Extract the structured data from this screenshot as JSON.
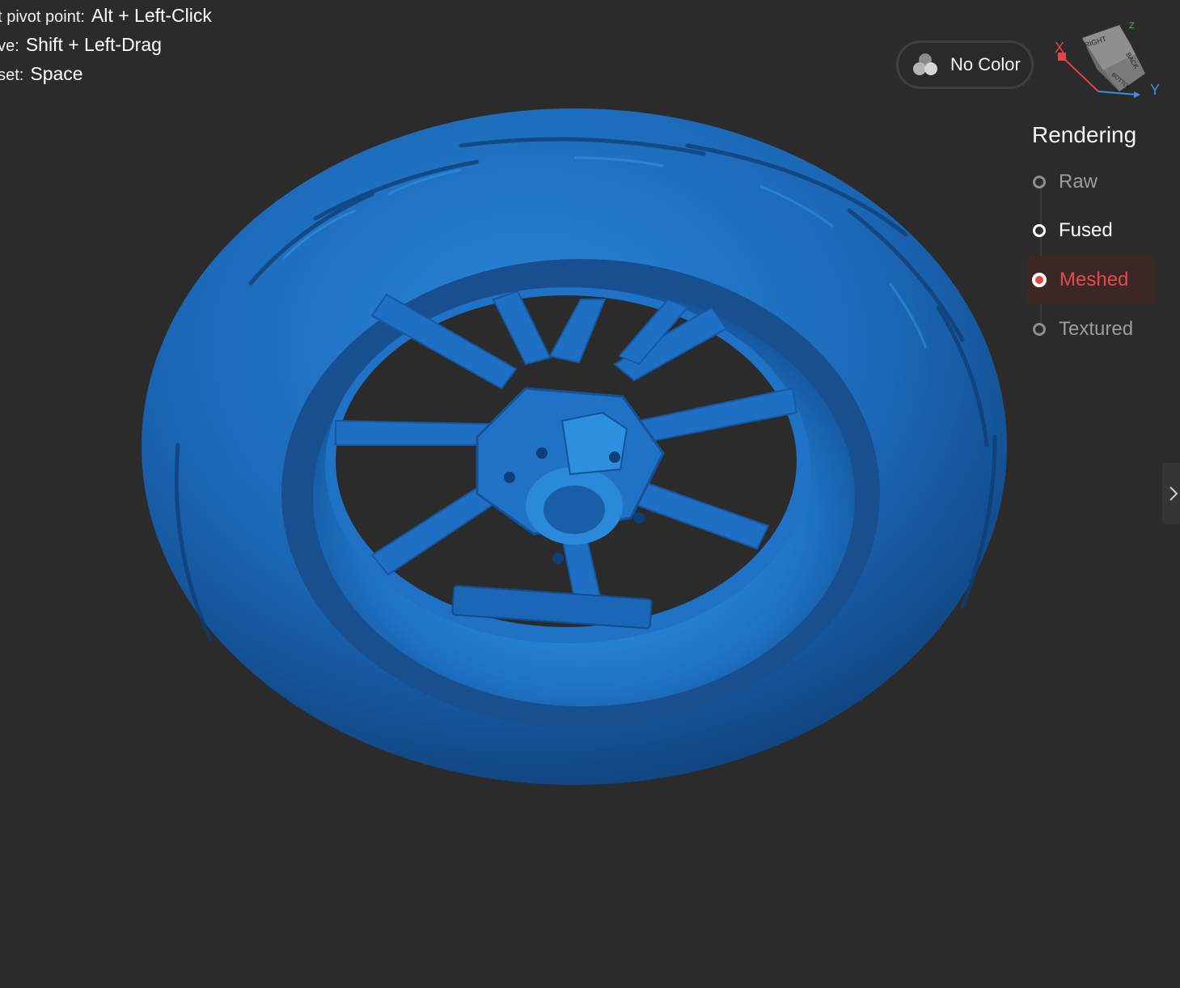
{
  "hints": [
    {
      "label": "et pivot point:",
      "key": "Alt + Left-Click"
    },
    {
      "label": "ove:",
      "key": "Shift + Left-Drag"
    },
    {
      "label": "eset:",
      "key": "Space"
    }
  ],
  "color_mode": {
    "label": "No Color",
    "icon": "color-circles-icon"
  },
  "view_cube": {
    "faces": [
      "RIGHT",
      "BACK",
      "BOTTOM"
    ],
    "axes": {
      "x": "X",
      "y": "Y",
      "z": "Z"
    },
    "axis_colors": {
      "x": "#e0454a",
      "y": "#3b8fe8",
      "z": "#3fbf5f"
    }
  },
  "rendering": {
    "title": "Rendering",
    "options": [
      "Raw",
      "Fused",
      "Meshed",
      "Textured"
    ],
    "selected": "Meshed"
  },
  "side_toggle": {
    "icon": "chevron-right-icon"
  },
  "colors": {
    "background": "#2b2b2b",
    "mesh": "#1e6fc0",
    "accent": "#e0454a"
  }
}
